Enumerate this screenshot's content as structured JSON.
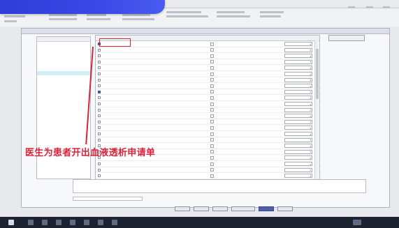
{
  "annotation": {
    "caption": "医生为患者开出血液透析申请单",
    "color": "#d8233a"
  },
  "left_panel": {
    "items": [
      "",
      "",
      "",
      "",
      "",
      "",
      "",
      "",
      "",
      "",
      "",
      ""
    ],
    "selected_index": 8
  },
  "grid": {
    "rows": [
      {
        "checked": true,
        "c1": "",
        "c2": "",
        "c3": ""
      },
      {
        "checked": false,
        "c1": "",
        "c2": "",
        "c3": ""
      },
      {
        "checked": false,
        "c1": "",
        "c2": "",
        "c3": ""
      },
      {
        "checked": false,
        "c1": "",
        "c2": "",
        "c3": ""
      },
      {
        "checked": false,
        "c1": "",
        "c2": "",
        "c3": ""
      },
      {
        "checked": false,
        "c1": "",
        "c2": "",
        "c3": ""
      },
      {
        "checked": false,
        "c1": "",
        "c2": "",
        "c3": ""
      },
      {
        "checked": false,
        "c1": "",
        "c2": "",
        "c3": ""
      },
      {
        "checked": true,
        "c1": "",
        "c2": "",
        "c3": ""
      },
      {
        "checked": false,
        "c1": "",
        "c2": "",
        "c3": ""
      },
      {
        "checked": false,
        "c1": "",
        "c2": "",
        "c3": ""
      },
      {
        "checked": false,
        "c1": "",
        "c2": "",
        "c3": ""
      },
      {
        "checked": false,
        "c1": "",
        "c2": "",
        "c3": ""
      },
      {
        "checked": false,
        "c1": "",
        "c2": "",
        "c3": ""
      },
      {
        "checked": false,
        "c1": "",
        "c2": "",
        "c3": ""
      },
      {
        "checked": false,
        "c1": "",
        "c2": "",
        "c3": ""
      },
      {
        "checked": false,
        "c1": "",
        "c2": "",
        "c3": ""
      },
      {
        "checked": false,
        "c1": "",
        "c2": "",
        "c3": ""
      },
      {
        "checked": false,
        "c1": "",
        "c2": "",
        "c3": ""
      },
      {
        "checked": false,
        "c1": "",
        "c2": "",
        "c3": ""
      },
      {
        "checked": false,
        "c1": "",
        "c2": "",
        "c3": ""
      },
      {
        "checked": false,
        "c1": "",
        "c2": "",
        "c3": ""
      },
      {
        "checked": false,
        "c1": "",
        "c2": "",
        "c3": ""
      },
      {
        "checked": false,
        "c1": "",
        "c2": "",
        "c3": ""
      }
    ]
  },
  "colors": {
    "screen_bg": "#e8e9ec",
    "sticker_blue": "#2f3ed8",
    "selected_row": "#cfeff6"
  },
  "icons": {
    "dropdown": "chevron-down-icon",
    "start": "start-icon"
  }
}
